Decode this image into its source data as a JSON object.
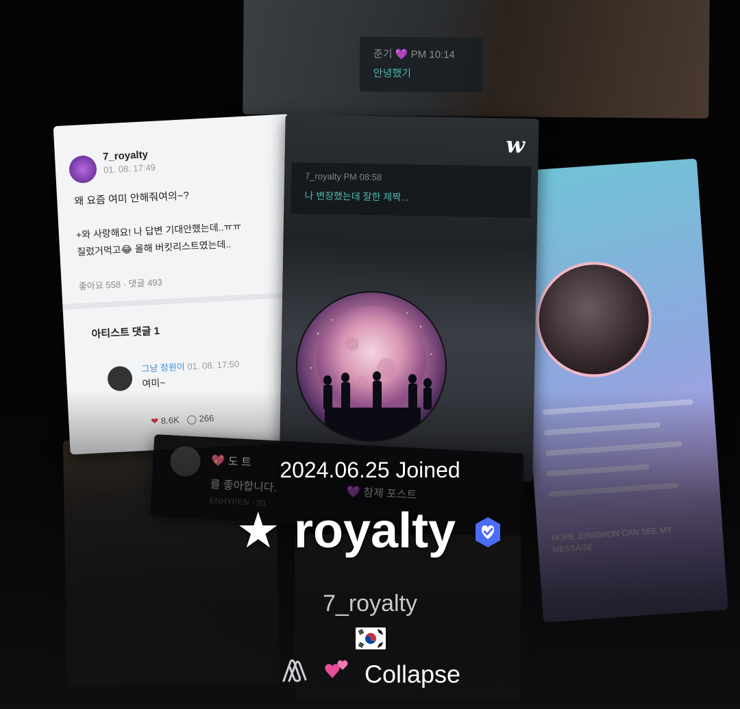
{
  "background": {
    "top_card": {
      "dm_meta": "준기 💜 PM 10:14",
      "dm_message": "안녕했기"
    },
    "post_card": {
      "username": "7_royalty",
      "date": "01. 08. 17:49",
      "line1": "왜 요즘 여미 안해줘여의~?",
      "line2": "+와 사랑해요! 나 답변 기대안했는데..ㅠㅠ",
      "line3": "질렀거먹고😂 올해 버킷리스트였는데..",
      "stats": "좋아요 558 · 댓글 493",
      "artist_comments": "아티스트 댓글 1",
      "comment_name": "그냥 정원이",
      "comment_date": "01. 08. 17:50",
      "comment_text": "여미~",
      "likes": "8.6K",
      "replies": "266"
    },
    "center_card": {
      "logo": "w",
      "dm_meta": "7_royalty PM 08:58",
      "dm_message": "나 변장했는데 잘한 제짝..."
    },
    "strip_card": {
      "line1": "💖 도 트",
      "line2": "를 좋아합니다.",
      "line2b": "💜 참제 포스트",
      "line3": "ENHYPEN · 20"
    },
    "right_card": {
      "chat_text": "HOPE JUNGWON CAN SEE MY MESSAGE"
    }
  },
  "profile": {
    "joined": "2024.06.25 Joined",
    "display_name": "★ royalty",
    "handle": "7_royalty",
    "bio_text": "Collapse"
  },
  "icons": {
    "verified": "verified-badge-icon",
    "flag": "south-korea-flag-icon",
    "bio_emoji": "paperclip-sparkling-hearts"
  },
  "colors": {
    "verified_badge": "#4a6cf7",
    "dm_accent": "#4fb6b0",
    "background": "#050505"
  }
}
